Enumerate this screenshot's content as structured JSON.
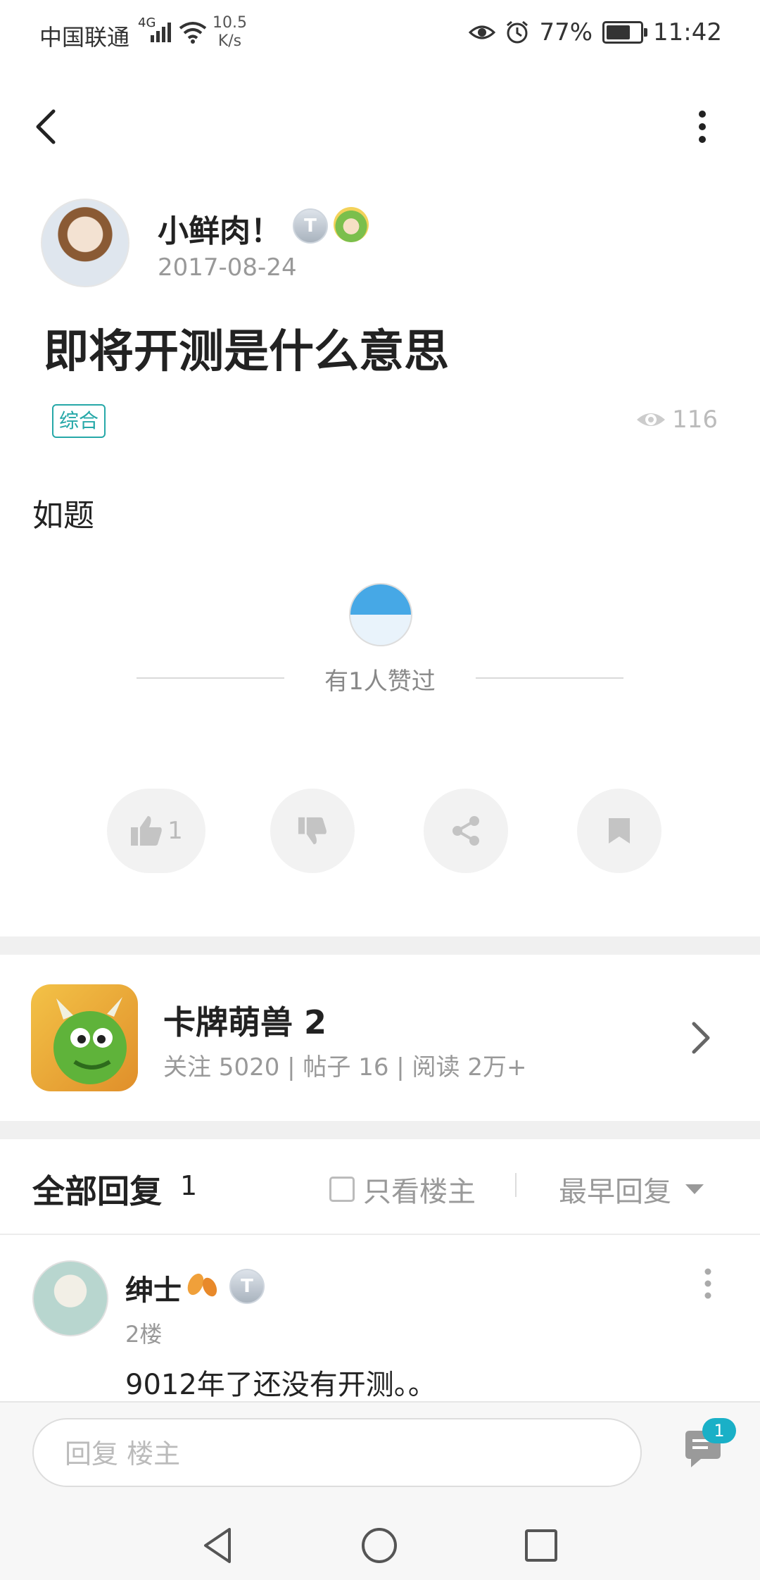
{
  "status_bar": {
    "carrier": "中国联通",
    "network": "4G",
    "speed_value": "10.5",
    "speed_unit": "K/s",
    "battery": "77%",
    "time": "11:42"
  },
  "post": {
    "author": "小鲜肉！",
    "author_level_badge": "T",
    "date": "2017-08-24",
    "title": "即将开测是什么意思",
    "tag": "综合",
    "views": "116",
    "content": "如题",
    "likers_text": "有1人赞过"
  },
  "actions": {
    "like_count": "1"
  },
  "game": {
    "name": "卡牌萌兽 2",
    "stats": "关注 5020 | 帖子 16 | 阅读 2万+"
  },
  "replies": {
    "title": "全部回复",
    "count": "1",
    "only_op_label": "只看楼主",
    "sort_label": "最早回复",
    "items": [
      {
        "author": "绅士",
        "level_badge": "T",
        "floor": "2楼",
        "text": "9012年了还没有开测。。"
      }
    ]
  },
  "reply_bar": {
    "placeholder": "回复  楼主",
    "comment_badge": "1"
  },
  "colors": {
    "accent": "#26a8a8",
    "badge": "#1ab0c7",
    "muted_text": "#999999"
  }
}
